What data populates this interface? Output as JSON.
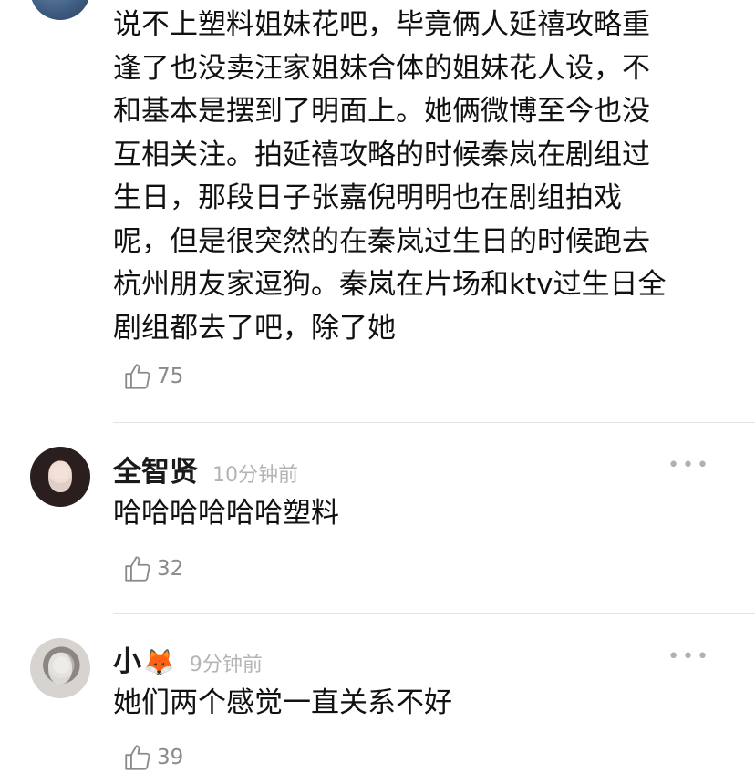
{
  "comments": [
    {
      "text": "说不上塑料姐妹花吧，毕竟俩人延禧攻略重逢了也没卖汪家姐妹合体的姐妹花人设，不和基本是摆到了明面上。她俩微博至今也没互相关注。拍延禧攻略的时候秦岚在剧组过生日，那段日子张嘉倪明明也在剧组拍戏呢，但是很突然的在秦岚过生日的时候跑去杭州朋友家逗狗。秦岚在片场和ktv过生日全剧组都去了吧，除了她",
      "lines": [
        "说不上塑料姐妹花吧，毕竟俩人延禧攻略重",
        "逢了也没卖汪家姐妹合体的姐妹花人设，不",
        "和基本是摆到了明面上。她俩微博至今也没",
        "互相关注。拍延禧攻略的时候秦岚在剧组过",
        "生日，那段日子张嘉倪明明也在剧组拍戏",
        "呢，但是很突然的在秦岚过生日的时候跑去",
        "杭州朋友家逗狗。秦岚在片场和ktv过生日全",
        "剧组都去了吧，除了她"
      ],
      "likes": "75"
    },
    {
      "username": "全智贤",
      "time": "10分钟前",
      "text": "哈哈哈哈哈哈塑料",
      "likes": "32",
      "more": "•••"
    },
    {
      "username": "小",
      "username_emoji": "🦊",
      "time": "9分钟前",
      "text": "她们两个感觉一直关系不好",
      "likes": "39",
      "more": "•••"
    }
  ],
  "icons": {
    "like": "thumbs-up-outline-icon",
    "more": "more-dots-icon"
  },
  "colors": {
    "text": "#111111",
    "meta": "#b4b4b4",
    "divider": "#e3e3e3",
    "like_count": "#8a8a8a"
  }
}
